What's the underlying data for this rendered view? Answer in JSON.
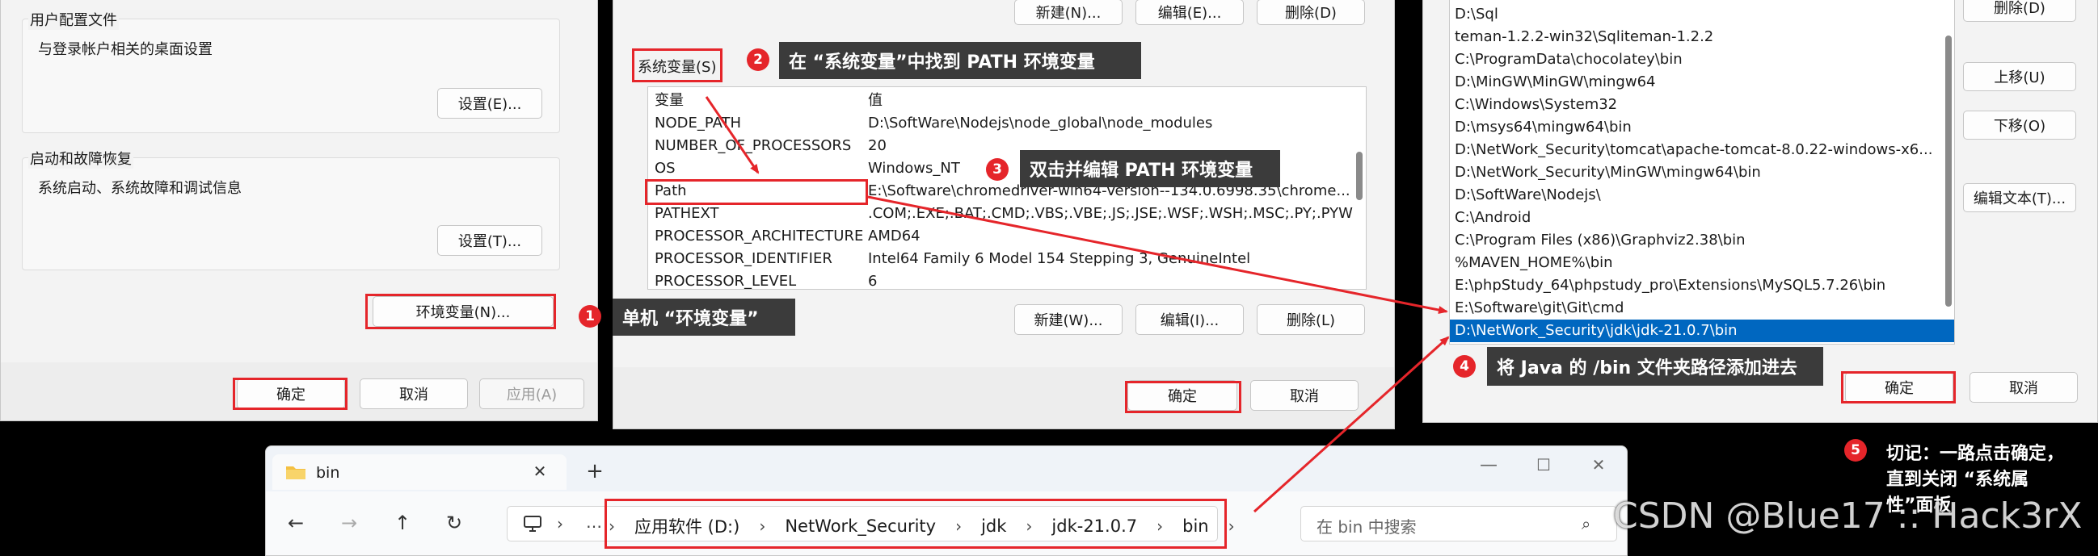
{
  "sys_props": {
    "user_profile_title": "用户配置文件",
    "user_profile_desc": "与登录帐户相关的桌面设置",
    "user_profile_settings": "设置(E)...",
    "startup_title": "启动和故障恢复",
    "startup_desc": "系统启动、系统故障和调试信息",
    "startup_settings": "设置(T)...",
    "env_button": "环境变量(N)...",
    "ok": "确定",
    "cancel": "取消",
    "apply": "应用(A)"
  },
  "env_dialog": {
    "top_new": "新建(N)...",
    "top_edit": "编辑(E)...",
    "top_delete": "删除(D)",
    "system_vars_label": "系统变量(S)",
    "col_var": "变量",
    "col_value": "值",
    "rows": [
      {
        "name": "NODE_PATH",
        "value": "D:\\SoftWare\\Nodejs\\node_global\\node_modules"
      },
      {
        "name": "NUMBER_OF_PROCESSORS",
        "value": "20"
      },
      {
        "name": "OS",
        "value": "Windows_NT"
      },
      {
        "name": "Path",
        "value": "E:\\Software\\chromedriver-win64-Version--134.0.6998.35\\chrome..."
      },
      {
        "name": "PATHEXT",
        "value": ".COM;.EXE;.BAT;.CMD;.VBS;.VBE;.JS;.JSE;.WSF;.WSH;.MSC;.PY;.PYW"
      },
      {
        "name": "PROCESSOR_ARCHITECTURE",
        "value": "AMD64"
      },
      {
        "name": "PROCESSOR_IDENTIFIER",
        "value": "Intel64 Family 6 Model 154 Stepping 3, GenuineIntel"
      },
      {
        "name": "PROCESSOR_LEVEL",
        "value": "6"
      }
    ],
    "new": "新建(W)...",
    "edit": "编辑(I)...",
    "delete": "删除(L)",
    "ok": "确定",
    "cancel": "取消"
  },
  "path_dialog": {
    "items": [
      "D:\\Sql",
      "teman-1.2.2-win32\\Sqliteman-1.2.2",
      "C:\\ProgramData\\chocolatey\\bin",
      "D:\\MinGW\\MinGW\\mingw64",
      "C:\\Windows\\System32",
      "D:\\msys64\\mingw64\\bin",
      "D:\\NetWork_Security\\tomcat\\apache-tomcat-8.0.22-windows-x6...",
      "D:\\NetWork_Security\\MinGW\\mingw64\\bin",
      "D:\\SoftWare\\Nodejs\\",
      "C:\\Android",
      "C:\\Program Files (x86)\\Graphviz2.38\\bin",
      "%MAVEN_HOME%\\bin",
      "E:\\phpStudy_64\\phpstudy_pro\\Extensions\\MySQL5.7.26\\bin",
      "E:\\Software\\git\\Git\\cmd",
      "D:\\NetWork_Security\\jdk\\jdk-21.0.7\\bin"
    ],
    "delete": "删除(D)",
    "move_up": "上移(U)",
    "move_down": "下移(O)",
    "edit_text": "编辑文本(T)...",
    "ok": "确定",
    "cancel": "取消"
  },
  "explorer": {
    "tab_title": "bin",
    "breadcrumb": [
      "应用软件 (D:)",
      "NetWork_Security",
      "jdk",
      "jdk-21.0.7",
      "bin"
    ],
    "search_placeholder": "在 bin 中搜索"
  },
  "annotations": {
    "a1": {
      "num": "1",
      "text": "单机 “环境变量”"
    },
    "a2": {
      "num": "2",
      "text": "在 “系统变量”中找到 PATH 环境变量"
    },
    "a3": {
      "num": "3",
      "text": "双击并编辑 PATH 环境变量"
    },
    "a4": {
      "num": "4",
      "text": "将 Java 的 /bin 文件夹路径添加进去"
    },
    "a5": {
      "num": "5",
      "line1": "切记：一路点击确定，",
      "line2": "直到关闭 “系统属",
      "line3": "性”面板"
    }
  },
  "watermark": "CSDN @Blue17 :: Hack3rX",
  "colors": {
    "annotation_red": "#e5252a",
    "selection_blue": "#0067c0",
    "label_bg": "#3b3b3b"
  }
}
